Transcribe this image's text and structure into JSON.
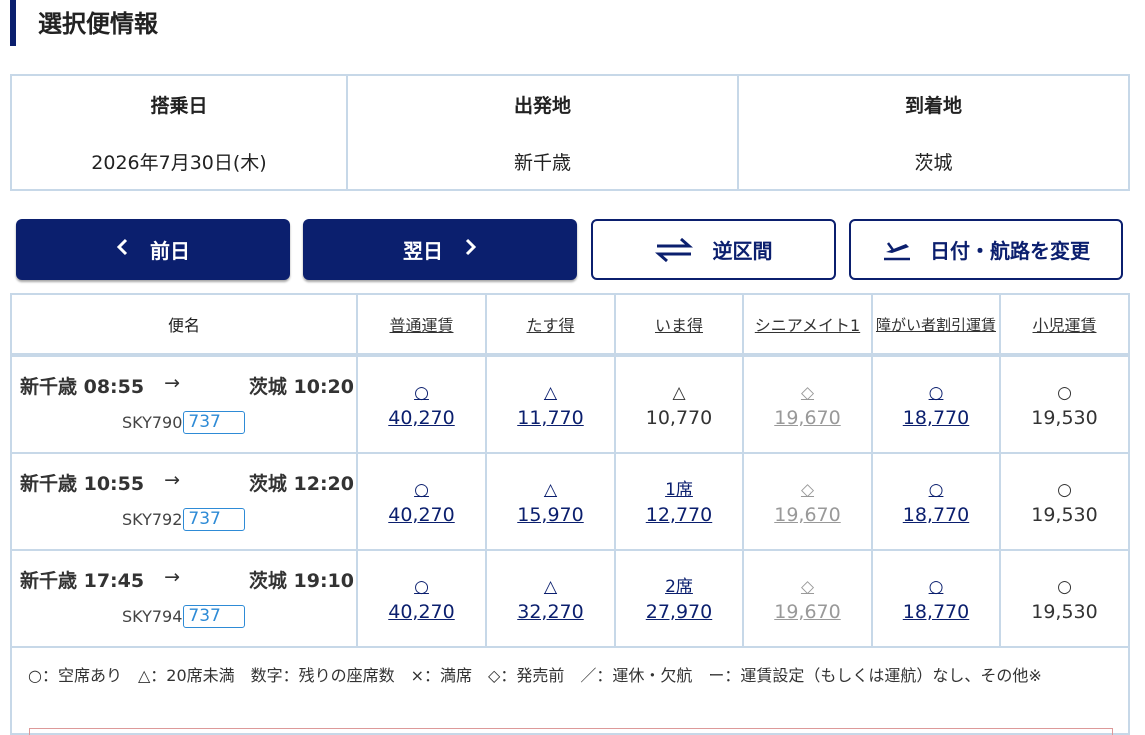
{
  "section_title": "選択便情報",
  "info": {
    "date_label": "搭乗日",
    "date_value": "2026年7月30日(木)",
    "from_label": "出発地",
    "from_value": "新千歳",
    "to_label": "到着地",
    "to_value": "茨城"
  },
  "buttons": {
    "prev_label": "前日",
    "next_label": "翌日",
    "reverse_label": "逆区間",
    "change_label": "日付・航路を変更"
  },
  "table": {
    "headers": {
      "flight": "便名",
      "fare1": "普通運賃",
      "fare2": "たす得",
      "fare3": "いま得",
      "fare4": "シニアメイト1",
      "fare5": "障がい者割引運賃",
      "fare6": "小児運賃"
    },
    "rows": [
      {
        "dep": "新千歳 08:55",
        "arrow": "→",
        "arr": "茨城 10:20",
        "flight_no": "SKY790",
        "aircraft": "737",
        "fares": [
          {
            "sym": "○",
            "price": "40,270"
          },
          {
            "sym": "△",
            "price": "11,770"
          },
          {
            "sym": "△",
            "price": "10,770"
          },
          {
            "sym": "◇",
            "price": "19,670"
          },
          {
            "sym": "○",
            "price": "18,770"
          },
          {
            "sym": "○",
            "price": "19,530"
          }
        ]
      },
      {
        "dep": "新千歳 10:55",
        "arrow": "→",
        "arr": "茨城 12:20",
        "flight_no": "SKY792",
        "aircraft": "737",
        "fares": [
          {
            "sym": "○",
            "price": "40,270"
          },
          {
            "sym": "△",
            "price": "15,970"
          },
          {
            "sym": "1席",
            "price": "12,770"
          },
          {
            "sym": "◇",
            "price": "19,670"
          },
          {
            "sym": "○",
            "price": "18,770"
          },
          {
            "sym": "○",
            "price": "19,530"
          }
        ]
      },
      {
        "dep": "新千歳 17:45",
        "arrow": "→",
        "arr": "茨城 19:10",
        "flight_no": "SKY794",
        "aircraft": "737",
        "fares": [
          {
            "sym": "○",
            "price": "40,270"
          },
          {
            "sym": "△",
            "price": "32,270"
          },
          {
            "sym": "2席",
            "price": "27,970"
          },
          {
            "sym": "◇",
            "price": "19,670"
          },
          {
            "sym": "○",
            "price": "18,770"
          },
          {
            "sym": "○",
            "price": "19,530"
          }
        ]
      }
    ]
  },
  "legend": "○：空席あり　△：20席未満　数字：残りの座席数　×：満席　◇：発売前　／：運休・欠航　ー：運賃設定（もしくは運航）なし、その他※",
  "colors": {
    "navy": "#0b1f6e",
    "border": "#c7d8e8",
    "aircraft_blue": "#2e8bd6",
    "disabled_gray": "#999999"
  }
}
